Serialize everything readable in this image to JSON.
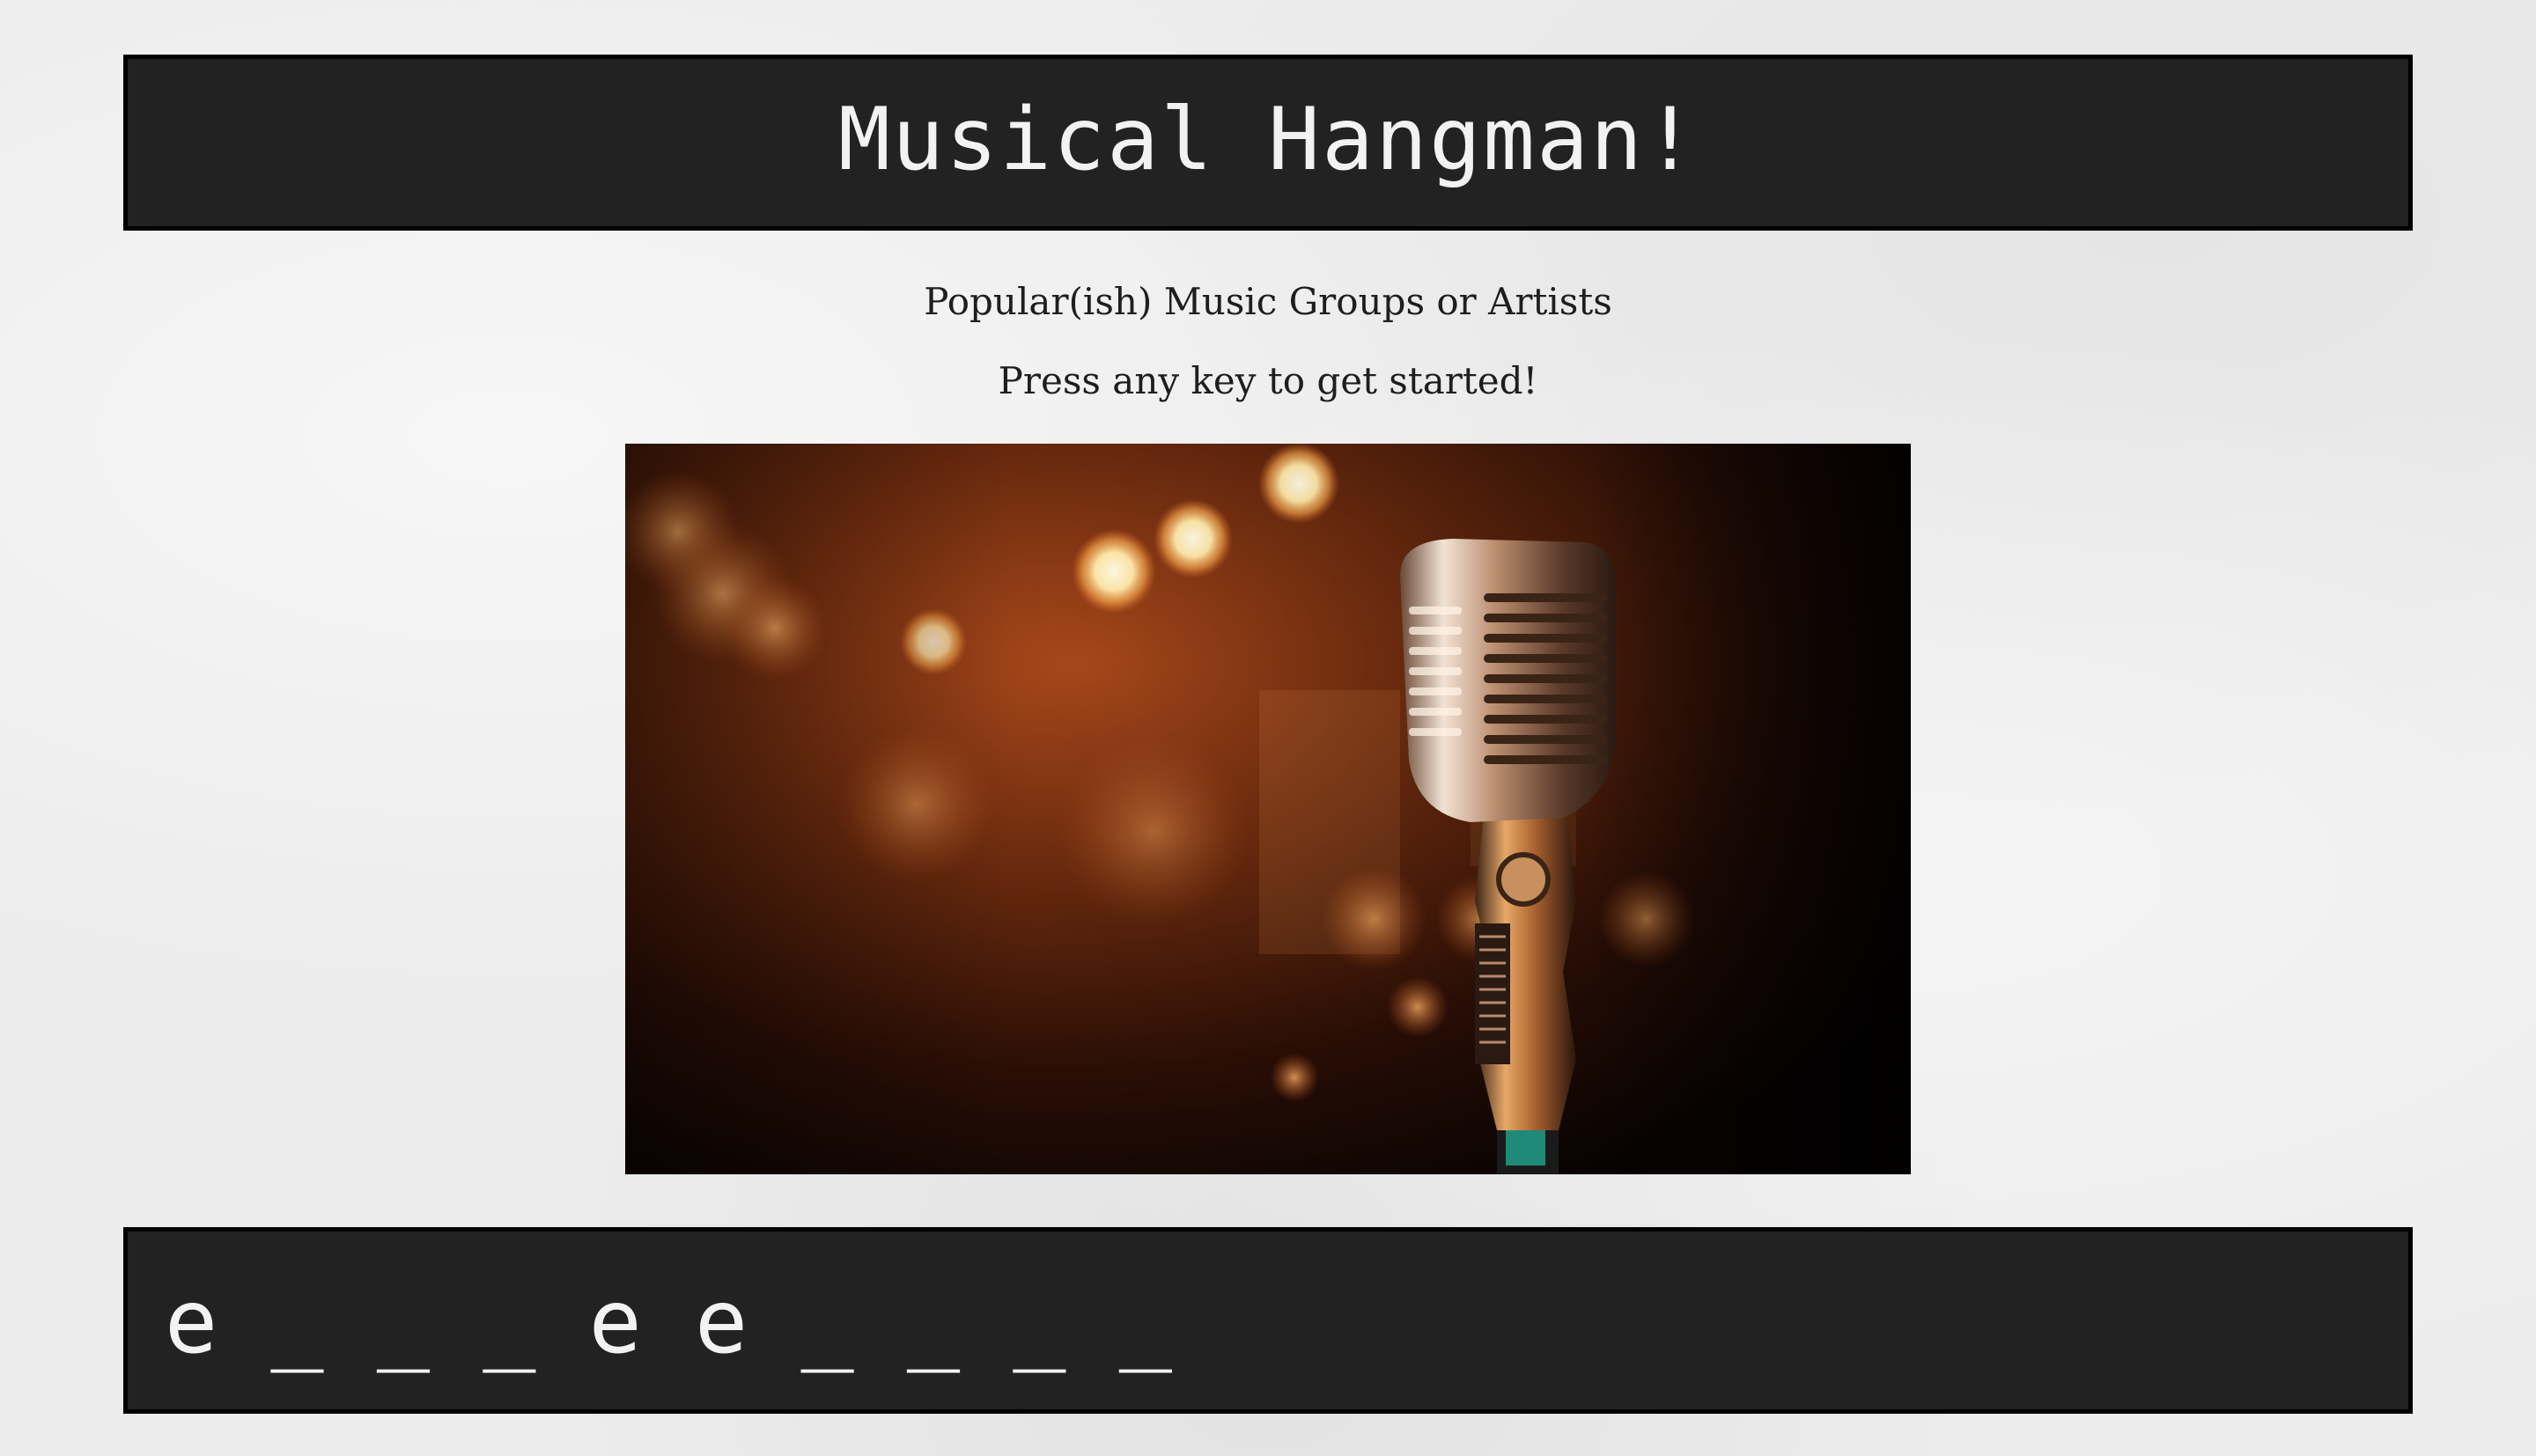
{
  "header": {
    "title": "Musical Hangman!"
  },
  "game": {
    "category": "Popular(ish) Music Groups or Artists",
    "prompt": "Press any key to get started!",
    "word_display": "e _ _ _ e e _ _ _ _"
  },
  "image": {
    "subject": "vintage microphone on stage with warm bokeh lights",
    "icon": "microphone-image"
  },
  "colors": {
    "page_background": "#ececec",
    "bar_background": "#222222",
    "bar_border": "#000000",
    "bar_text": "#f2f2f2",
    "body_text": "#1e1e1e",
    "stage_glow": "#e07a2a"
  }
}
